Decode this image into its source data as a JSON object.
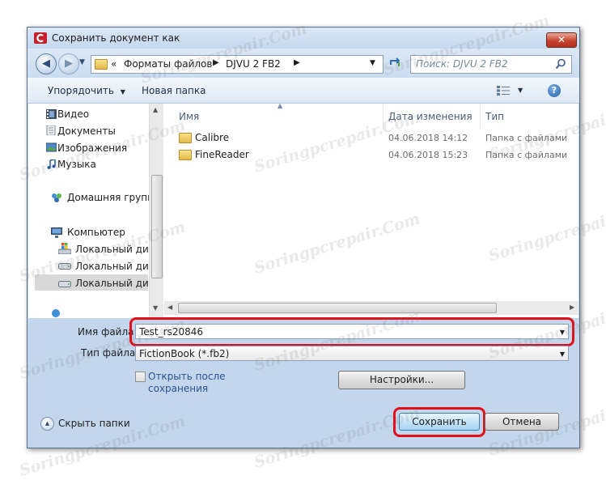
{
  "window": {
    "title": "Сохранить документ как",
    "close_symbol": "✕"
  },
  "nav": {
    "back_symbol": "◀",
    "forward_symbol": "▶",
    "breadcrumb_prefix": "«",
    "breadcrumb": [
      "Форматы файлов",
      "DJVU 2 FB2"
    ],
    "search_placeholder": "Поиск: DJVU 2 FB2"
  },
  "toolbar": {
    "organize_label": "Упорядочить",
    "new_folder_label": "Новая папка",
    "help_symbol": "?"
  },
  "sidebar": {
    "items": [
      {
        "label": "Видео",
        "icon": "video-icon"
      },
      {
        "label": "Документы",
        "icon": "documents-icon"
      },
      {
        "label": "Изображения",
        "icon": "pictures-icon"
      },
      {
        "label": "Музыка",
        "icon": "music-icon"
      },
      {
        "label": "Домашняя группа",
        "icon": "homegroup-icon"
      },
      {
        "label": "Компьютер",
        "icon": "computer-icon"
      },
      {
        "label": "Локальный диск",
        "icon": "drive-icon"
      },
      {
        "label": "Локальный диск",
        "icon": "drive-icon"
      },
      {
        "label": "Локальный диск",
        "icon": "drive-icon",
        "selected": true
      }
    ]
  },
  "files": {
    "columns": {
      "name": "Имя",
      "date": "Дата изменения",
      "type": "Тип"
    },
    "rows": [
      {
        "name": "Calibre",
        "date": "04.06.2018 14:12",
        "type": "Папка с файлами"
      },
      {
        "name": "FineReader",
        "date": "04.06.2018 15:23",
        "type": "Папка с файлами"
      }
    ]
  },
  "form": {
    "filename_label": "Имя файла:",
    "filename_value": "Test_rs20846",
    "filetype_label": "Тип файла:",
    "filetype_value": "FictionBook (*.fb2)",
    "open_after_label_line1": "Открыть после",
    "open_after_label_line2": "сохранения",
    "open_after_checked": false,
    "settings_label": "Настройки..."
  },
  "footer": {
    "hide_folders_label": "Скрыть папки",
    "save_label": "Сохранить",
    "cancel_label": "Отмена"
  },
  "watermark": "Soringpcrepair.Com",
  "colors": {
    "highlight": "#e0101b",
    "accent": "#2f5f9f",
    "window_frame": "#c3d6ec"
  }
}
